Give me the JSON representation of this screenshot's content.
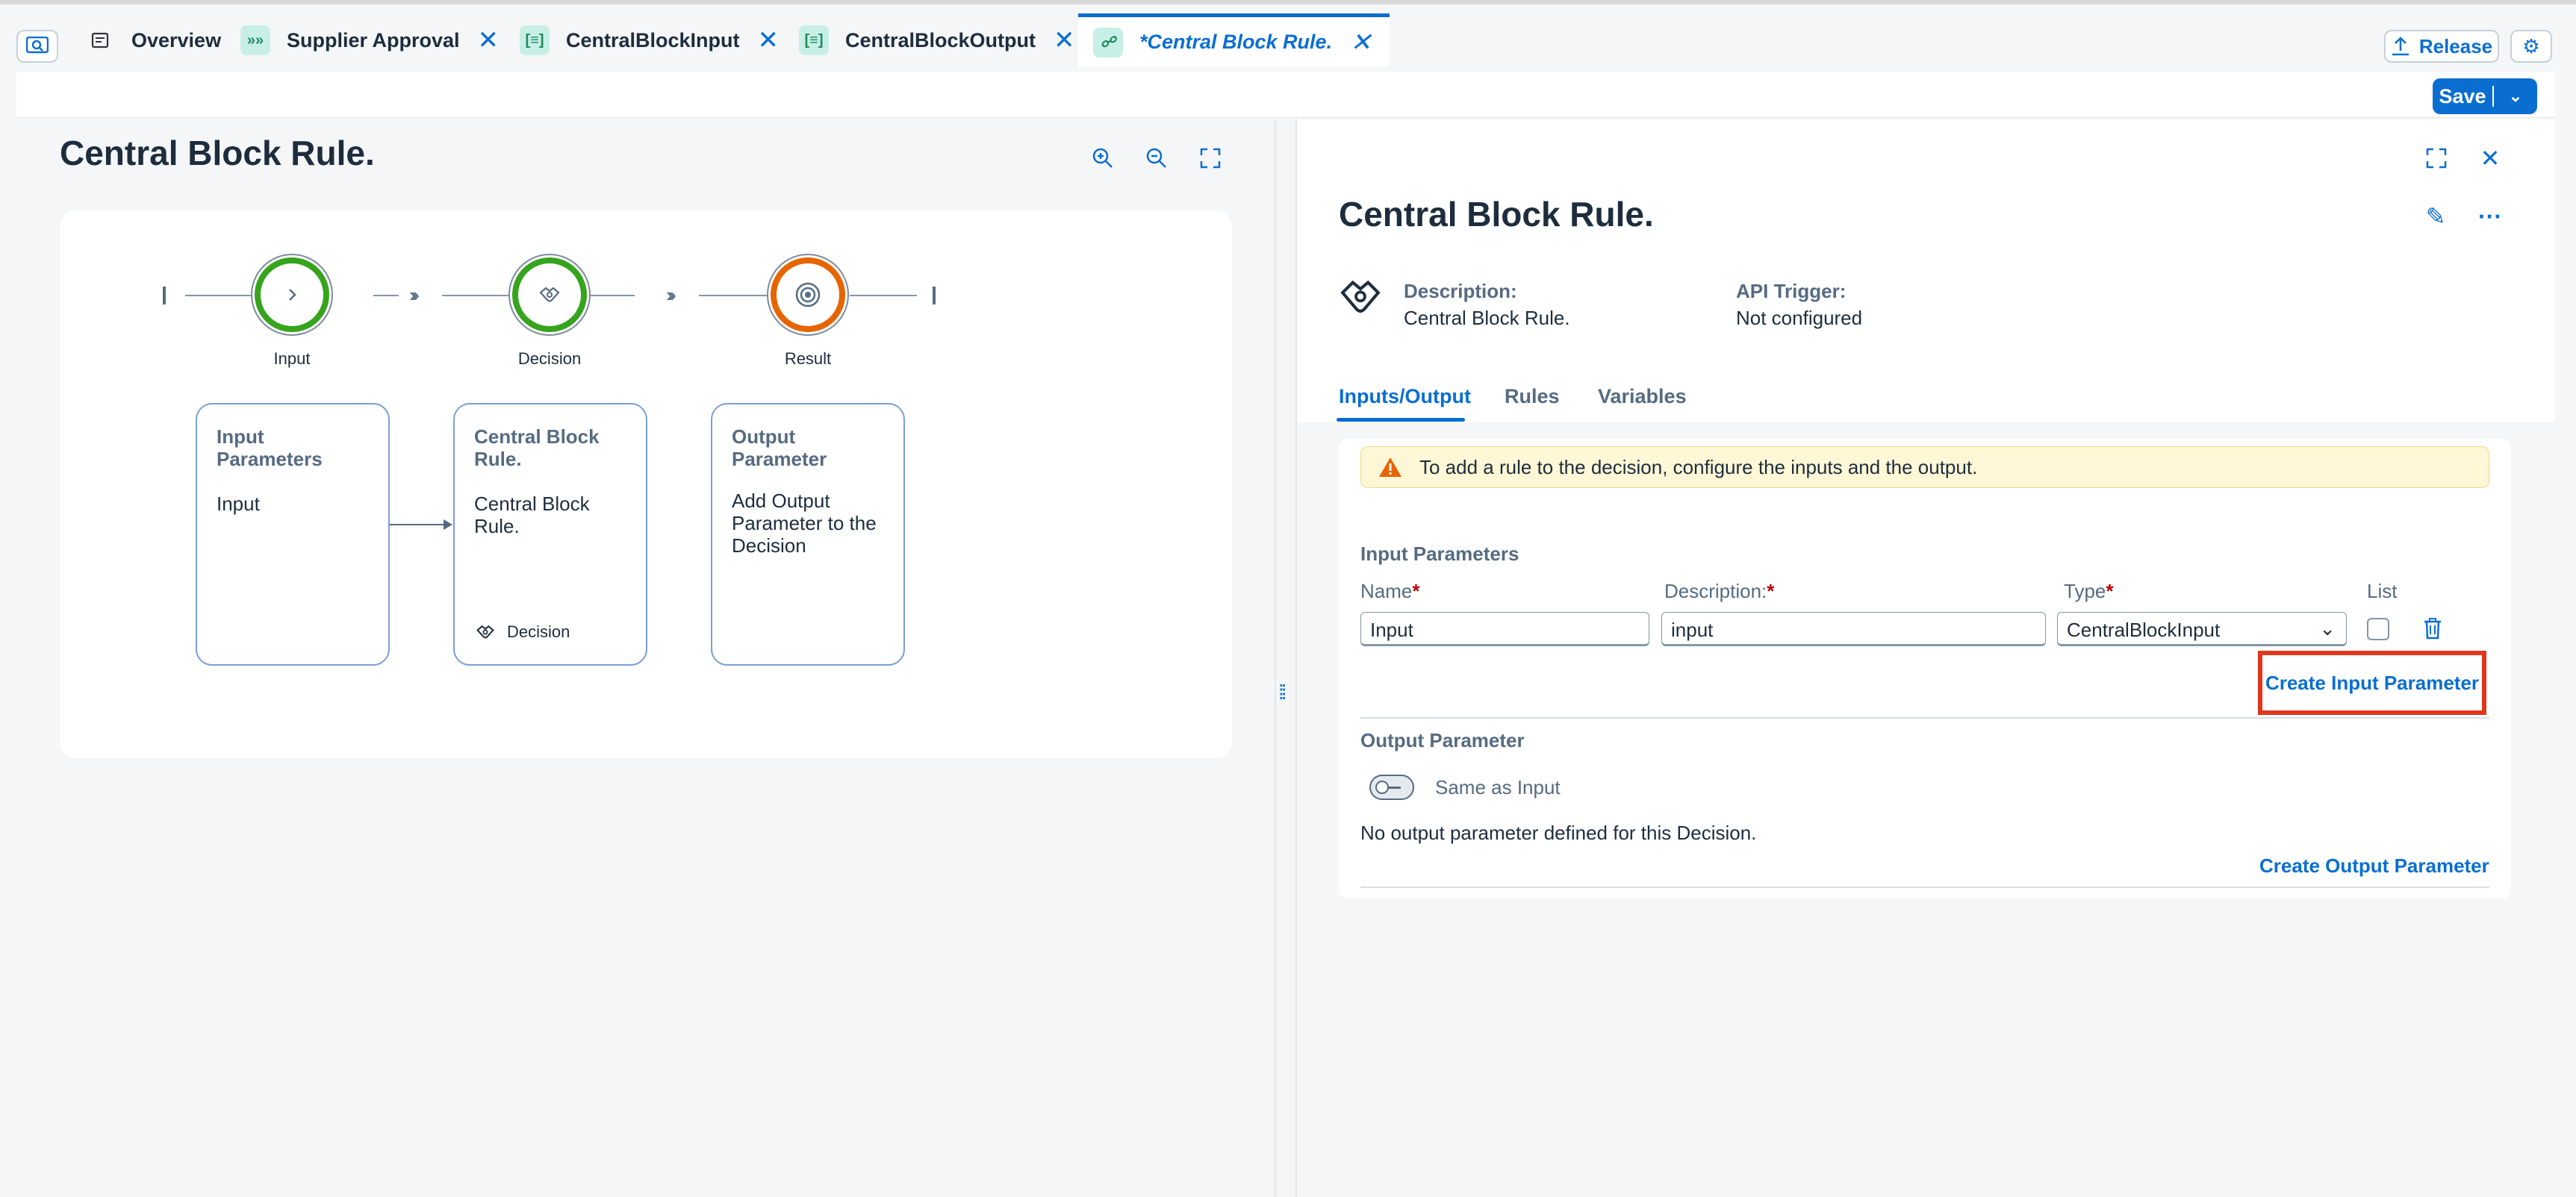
{
  "tabs": [
    {
      "label": "Overview",
      "icon": "overview-icon"
    },
    {
      "label": "Supplier Approval",
      "icon": "process-icon"
    },
    {
      "label": "CentralBlockInput",
      "icon": "data-type-icon"
    },
    {
      "label": "CentralBlockOutput",
      "icon": "data-type-icon"
    },
    {
      "label": "*Central Block Rule.",
      "icon": "decision-icon",
      "active": true
    }
  ],
  "toolbar": {
    "release_label": "Release",
    "save_label": "Save"
  },
  "left": {
    "title": "Central Block Rule.",
    "flow": {
      "nodes": [
        {
          "label": "Input",
          "color": "#36a41d"
        },
        {
          "label": "Decision",
          "color": "#36a41d"
        },
        {
          "label": "Result",
          "color": "#e76500"
        }
      ],
      "cards": [
        {
          "title": "Input Parameters",
          "body": "Input"
        },
        {
          "title": "Central Block Rule.",
          "body": "Central Block Rule.",
          "footer": "Decision"
        },
        {
          "title": "Output Parameter",
          "body": "Add Output Parameter to the Decision"
        }
      ]
    }
  },
  "right": {
    "title": "Central Block Rule.",
    "description_label": "Description:",
    "description_value": "Central Block Rule.",
    "api_trigger_label": "API Trigger:",
    "api_trigger_value": "Not configured",
    "tabs": [
      "Inputs/Output",
      "Rules",
      "Variables"
    ],
    "active_tab": "Inputs/Output",
    "warning": "To add a rule to the decision, configure the inputs and the output.",
    "input_section": {
      "title": "Input Parameters",
      "columns": {
        "name": "Name",
        "description": "Description:",
        "type": "Type",
        "list": "List"
      },
      "row": {
        "name": "Input",
        "description": "input",
        "type": "CentralBlockInput",
        "list": false
      },
      "create_label": "Create Input Parameter"
    },
    "output_section": {
      "title": "Output Parameter",
      "toggle_label": "Same as Input",
      "toggle_on": false,
      "empty_text": "No output parameter defined for this Decision.",
      "create_label": "Create Output Parameter"
    }
  },
  "colors": {
    "accent": "#0a6ed1",
    "success": "#36a41d",
    "orange": "#e76500",
    "warning_bg": "#fff7d6",
    "highlight": "#e0361b"
  }
}
